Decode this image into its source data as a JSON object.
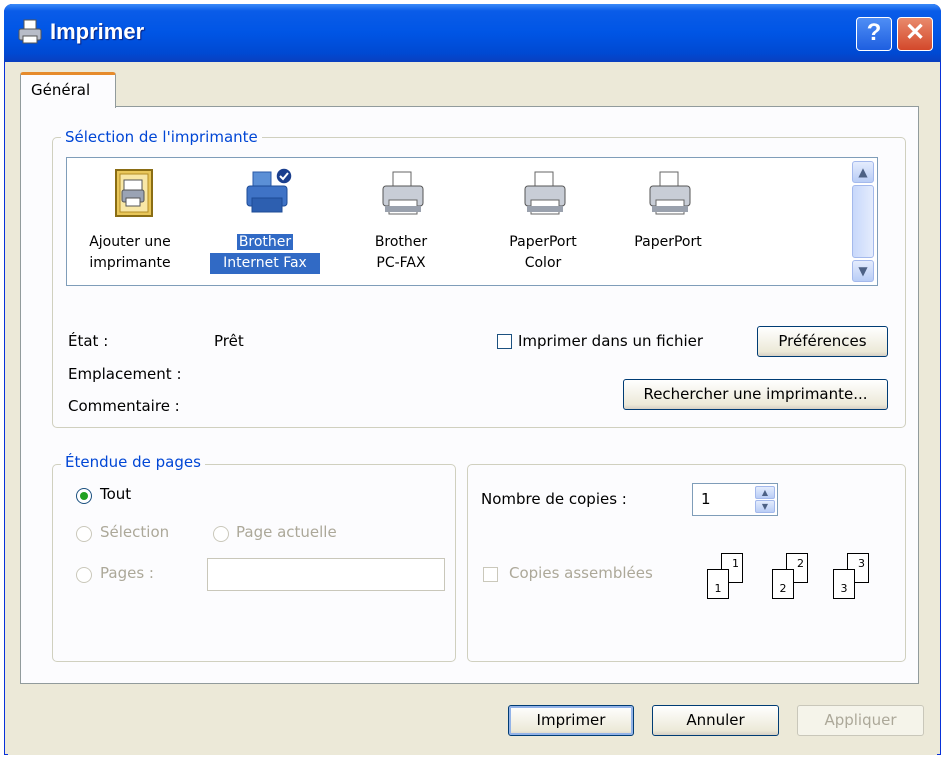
{
  "window": {
    "title": "Imprimer",
    "help_label": "?",
    "close_label": "✕"
  },
  "tabs": [
    {
      "label": "Général"
    }
  ],
  "printer_selection": {
    "legend": "Sélection de l'imprimante",
    "printers": [
      {
        "line1": "Ajouter une",
        "line2": "imprimante",
        "icon": "add-printer-icon"
      },
      {
        "line1": "Brother",
        "line2": "Internet Fax",
        "icon": "fax-printer-icon",
        "selected": true
      },
      {
        "line1": "Brother",
        "line2": "PC-FAX",
        "icon": "printer-icon"
      },
      {
        "line1": "PaperPort",
        "line2": "Color",
        "icon": "printer-icon"
      },
      {
        "line1": "PaperPort",
        "line2": "",
        "icon": "printer-icon"
      }
    ],
    "state_label": "État :",
    "state_value": "Prêt",
    "location_label": "Emplacement :",
    "comment_label": "Commentaire :",
    "print_to_file_label": "Imprimer dans un fichier",
    "preferences_label": "Préférences",
    "find_printer_label": "Rechercher une imprimante..."
  },
  "page_range": {
    "legend": "Étendue de pages",
    "all_label": "Tout",
    "selection_label": "Sélection",
    "current_page_label": "Page actuelle",
    "pages_label": "Pages :",
    "pages_value": ""
  },
  "copies": {
    "count_label": "Nombre de copies :",
    "count_value": "1",
    "collate_label": "Copies assemblées",
    "collate_pairs": [
      [
        "1",
        "1"
      ],
      [
        "2",
        "2"
      ],
      [
        "3",
        "3"
      ]
    ]
  },
  "buttons": {
    "print": "Imprimer",
    "cancel": "Annuler",
    "apply": "Appliquer"
  }
}
